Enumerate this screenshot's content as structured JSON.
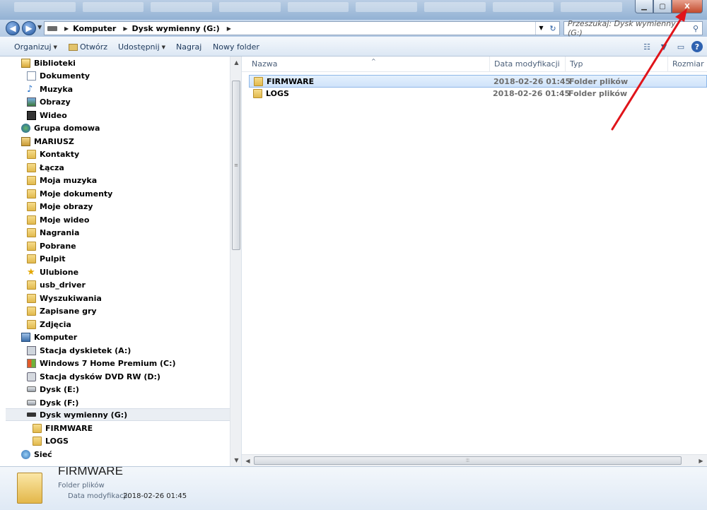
{
  "window": {
    "minimize_glyph": "▁",
    "maximize_glyph": "▢",
    "close_glyph": "X"
  },
  "address": {
    "back_glyph": "◀",
    "forward_glyph": "▶",
    "breadcrumbs": [
      "Komputer",
      "Dysk wymienny (G:)"
    ],
    "refresh_glyph": "↻"
  },
  "search": {
    "placeholder": "Przeszukaj: Dysk wymienny (G:)"
  },
  "toolbar": {
    "organize": "Organizuj",
    "open": "Otwórz",
    "share": "Udostępnij",
    "burn": "Nagraj",
    "new_folder": "Nowy folder",
    "help_glyph": "?"
  },
  "nav": {
    "items": [
      {
        "label": "Biblioteki",
        "icon": "library-icon"
      },
      {
        "label": "Dokumenty",
        "icon": "documents-icon"
      },
      {
        "label": "Muzyka",
        "icon": "music-icon"
      },
      {
        "label": "Obrazy",
        "icon": "pictures-icon"
      },
      {
        "label": "Wideo",
        "icon": "video-icon"
      },
      {
        "label": "Grupa domowa",
        "icon": "homegroup-icon"
      },
      {
        "label": "MARIUSZ",
        "icon": "user-folder-icon"
      },
      {
        "label": "Kontakty",
        "icon": "folder-icon"
      },
      {
        "label": "Łącza",
        "icon": "folder-icon"
      },
      {
        "label": "Moja muzyka",
        "icon": "folder-icon"
      },
      {
        "label": "Moje dokumenty",
        "icon": "folder-icon"
      },
      {
        "label": "Moje obrazy",
        "icon": "folder-icon"
      },
      {
        "label": "Moje wideo",
        "icon": "folder-icon"
      },
      {
        "label": "Nagrania",
        "icon": "folder-icon"
      },
      {
        "label": "Pobrane",
        "icon": "folder-icon"
      },
      {
        "label": "Pulpit",
        "icon": "folder-icon"
      },
      {
        "label": "Ulubione",
        "icon": "favorites-icon"
      },
      {
        "label": "usb_driver",
        "icon": "folder-icon"
      },
      {
        "label": "Wyszukiwania",
        "icon": "folder-icon"
      },
      {
        "label": "Zapisane gry",
        "icon": "folder-icon"
      },
      {
        "label": "Zdjęcia",
        "icon": "folder-icon"
      },
      {
        "label": "Komputer",
        "icon": "computer-icon"
      },
      {
        "label": "Stacja dyskietek (A:)",
        "icon": "floppy-drive-icon"
      },
      {
        "label": "Windows 7 Home Premium (C:)",
        "icon": "windows-drive-icon"
      },
      {
        "label": "Stacja dysków DVD RW (D:)",
        "icon": "dvd-drive-icon"
      },
      {
        "label": "Dysk (E:)",
        "icon": "hard-drive-icon"
      },
      {
        "label": "Dysk (F:)",
        "icon": "hard-drive-icon"
      },
      {
        "label": "Dysk wymienny (G:)",
        "icon": "removable-drive-icon"
      },
      {
        "label": "FIRMWARE",
        "icon": "folder-icon"
      },
      {
        "label": "LOGS",
        "icon": "folder-icon"
      },
      {
        "label": "Sieć",
        "icon": "network-icon"
      }
    ]
  },
  "columns": {
    "name": "Nazwa",
    "date": "Data modyfikacji",
    "type": "Typ",
    "size": "Rozmiar"
  },
  "files": [
    {
      "name": "FIRMWARE",
      "date": "2018-02-26 01:45",
      "type": "Folder plików"
    },
    {
      "name": "LOGS",
      "date": "2018-02-26 01:45",
      "type": "Folder plików"
    }
  ],
  "details": {
    "name": "FIRMWARE",
    "type": "Folder plików",
    "modified_label": "Data modyfikacji:",
    "modified_value": "2018-02-26 01:45"
  },
  "colors": {
    "annotation_arrow": "#e0141a",
    "selection": "#cfe3fa",
    "accent": "#2f62b0"
  }
}
